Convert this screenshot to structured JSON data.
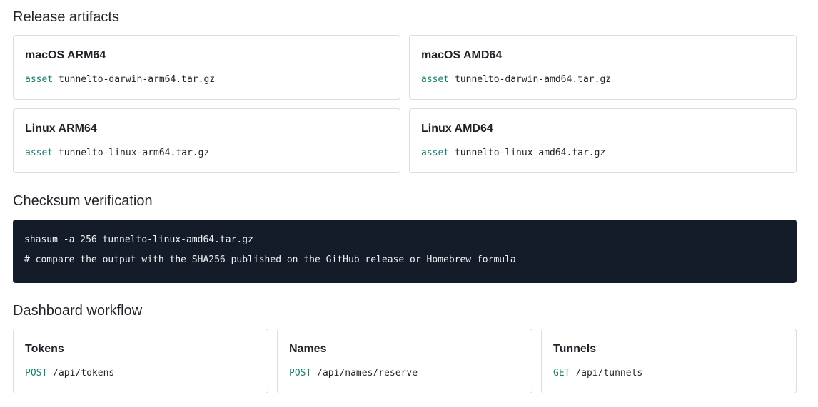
{
  "artifacts": {
    "title": "Release artifacts",
    "cards": [
      {
        "name": "macOS ARM64",
        "label": "asset",
        "file": "tunnelto-darwin-arm64.tar.gz"
      },
      {
        "name": "macOS AMD64",
        "label": "asset",
        "file": "tunnelto-darwin-amd64.tar.gz"
      },
      {
        "name": "Linux ARM64",
        "label": "asset",
        "file": "tunnelto-linux-arm64.tar.gz"
      },
      {
        "name": "Linux AMD64",
        "label": "asset",
        "file": "tunnelto-linux-amd64.tar.gz"
      }
    ]
  },
  "checksum": {
    "title": "Checksum verification",
    "lines": [
      "shasum -a 256 tunnelto-linux-amd64.tar.gz",
      "# compare the output with the SHA256 published on the GitHub release or Homebrew formula"
    ]
  },
  "workflow": {
    "title": "Dashboard workflow",
    "cards": [
      {
        "name": "Tokens",
        "method": "POST",
        "path": "/api/tokens"
      },
      {
        "name": "Names",
        "method": "POST",
        "path": "/api/names/reserve"
      },
      {
        "name": "Tunnels",
        "method": "GET",
        "path": "/api/tunnels"
      }
    ]
  },
  "colors": {
    "keyword": "#1a7f6e",
    "code_bg": "#141b29",
    "border": "#d8dee4"
  }
}
